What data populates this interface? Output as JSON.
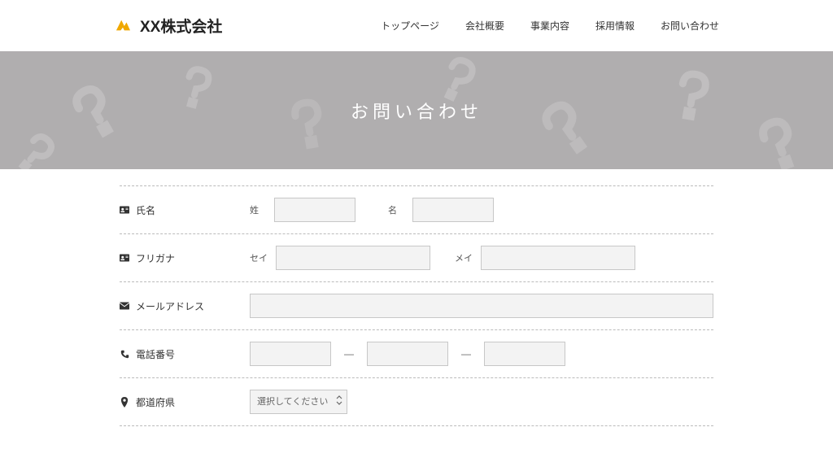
{
  "header": {
    "company": "XX株式会社",
    "nav": {
      "top": "トップページ",
      "about": "会社概要",
      "business": "事業内容",
      "careers": "採用情報",
      "contact": "お問い合わせ"
    }
  },
  "hero": {
    "title": "お問い合わせ"
  },
  "form": {
    "name": {
      "label": "氏名",
      "last_sub": "姓",
      "first_sub": "名"
    },
    "furigana": {
      "label": "フリガナ",
      "last_sub": "セイ",
      "first_sub": "メイ"
    },
    "email": {
      "label": "メールアドレス"
    },
    "phone": {
      "label": "電話番号",
      "sep": "—"
    },
    "prefecture": {
      "label": "都道府県",
      "placeholder": "選択してください"
    }
  }
}
